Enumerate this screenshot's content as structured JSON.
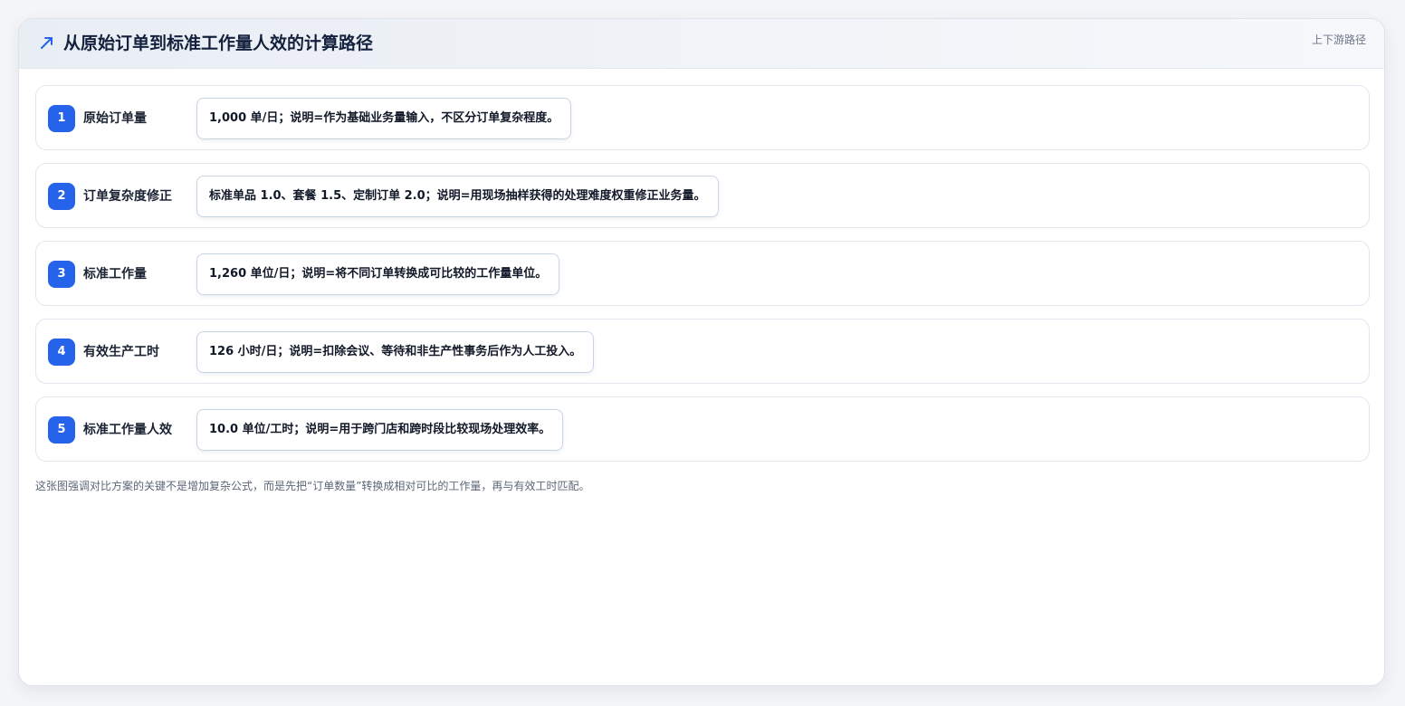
{
  "header": {
    "icon": "trend-up-arrow-icon",
    "title": "从原始订单到标准工作量人效的计算路径",
    "tag": "上下游路径"
  },
  "accent_color": "#2563eb",
  "steps": [
    {
      "num": "1",
      "label": "原始订单量",
      "text": "1,000 单/日；说明=作为基础业务量输入，不区分订单复杂程度。"
    },
    {
      "num": "2",
      "label": "订单复杂度修正",
      "text": "标准单品 1.0、套餐 1.5、定制订单 2.0；说明=用现场抽样获得的处理难度权重修正业务量。"
    },
    {
      "num": "3",
      "label": "标准工作量",
      "text": "1,260 单位/日；说明=将不同订单转换成可比较的工作量单位。"
    },
    {
      "num": "4",
      "label": "有效生产工时",
      "text": "126 小时/日；说明=扣除会议、等待和非生产性事务后作为人工投入。"
    },
    {
      "num": "5",
      "label": "标准工作量人效",
      "text": "10.0 单位/工时；说明=用于跨门店和跨时段比较现场处理效率。"
    }
  ],
  "footnote": "这张图强调对比方案的关键不是增加复杂公式，而是先把“订单数量”转换成相对可比的工作量，再与有效工时匹配。"
}
